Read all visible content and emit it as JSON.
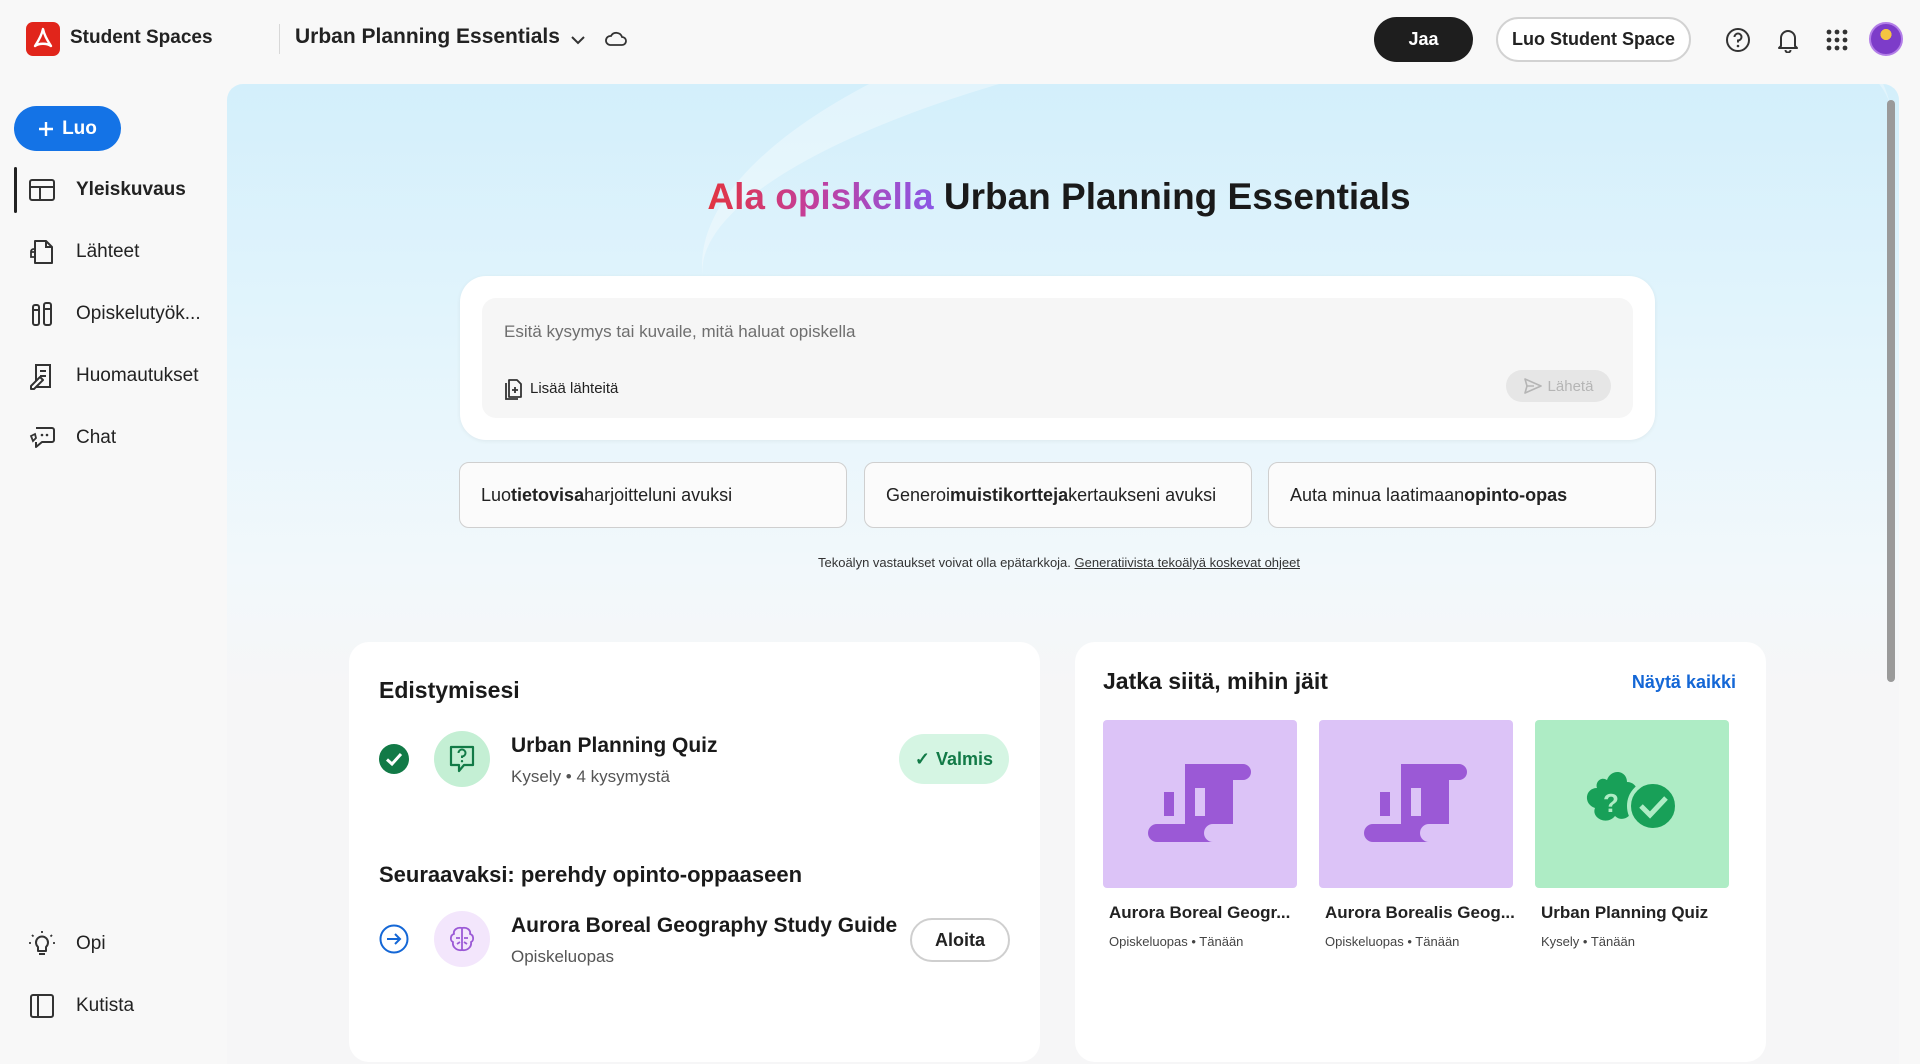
{
  "app": {
    "brand": "Student Spaces",
    "space_title": "Urban Planning Essentials"
  },
  "header": {
    "share_label": "Jaa",
    "create_space_label": "Luo Student Space"
  },
  "sidebar": {
    "new_label": "Luo",
    "items": [
      {
        "label": "Yleiskuvaus",
        "icon": "overview-icon"
      },
      {
        "label": "Lähteet",
        "icon": "sources-icon"
      },
      {
        "label": "Opiskelutyök...",
        "icon": "study-tools-icon"
      },
      {
        "label": "Huomautukset",
        "icon": "notes-icon"
      },
      {
        "label": "Chat",
        "icon": "chat-icon"
      }
    ],
    "bottom": [
      {
        "label": "Opi",
        "icon": "lightbulb-icon"
      },
      {
        "label": "Kutista",
        "icon": "collapse-panel-icon"
      }
    ]
  },
  "main": {
    "hero_prefix": "Ala opiskella",
    "hero_subject": "Urban Planning Essentials",
    "composer": {
      "placeholder": "Esitä kysymys tai kuvaile, mitä haluat opiskella",
      "add_sources_label": "Lisää lähteitä",
      "send_label": "Lähetä"
    },
    "suggestions": [
      {
        "pre": "Luo ",
        "bold": "tietovisa",
        "post": " harjoitteluni avuksi"
      },
      {
        "pre": "Generoi ",
        "bold": "muistikortteja",
        "post": " kertaukseni avuksi"
      },
      {
        "pre": "Auta minua laatimaan ",
        "bold": "opinto-opas",
        "post": ""
      }
    ],
    "disclaimer_text": "Tekoälyn vastaukset voivat olla epätarkkoja.",
    "disclaimer_link": "Generatiivista tekoälyä koskevat ohjeet"
  },
  "progress": {
    "title": "Edistymisesi",
    "completed_item": {
      "title": "Urban Planning Quiz",
      "subtitle": "Kysely • 4 kysymystä",
      "status": "Valmis"
    },
    "next_heading": "Seuraavaksi: perehdy opinto-oppaaseen",
    "next_item": {
      "title": "Aurora Boreal Geography Study Guide",
      "subtitle": "Opiskeluopas",
      "action": "Aloita"
    }
  },
  "continue": {
    "title": "Jatka siitä, mihin jäit",
    "see_all": "Näytä kaikki",
    "items": [
      {
        "title": "Aurora Boreal Geogr...",
        "subtitle": "Opiskeluopas • Tänään",
        "color": "#dcc3f7",
        "icon": "study-guide-scroll-icon"
      },
      {
        "title": "Aurora Borealis Geog...",
        "subtitle": "Opiskeluopas • Tänään",
        "color": "#dcc3f7",
        "icon": "study-guide-scroll-icon"
      },
      {
        "title": "Urban Planning Quiz",
        "subtitle": "Kysely • Tänään",
        "color": "#aeecc5",
        "icon": "quiz-check-icon"
      }
    ]
  },
  "colors": {
    "accent_blue": "#1473e6",
    "brand_red": "#e1251b",
    "success_green": "#127a47",
    "study_purple": "#9b59d6",
    "quiz_green": "#18a058"
  }
}
